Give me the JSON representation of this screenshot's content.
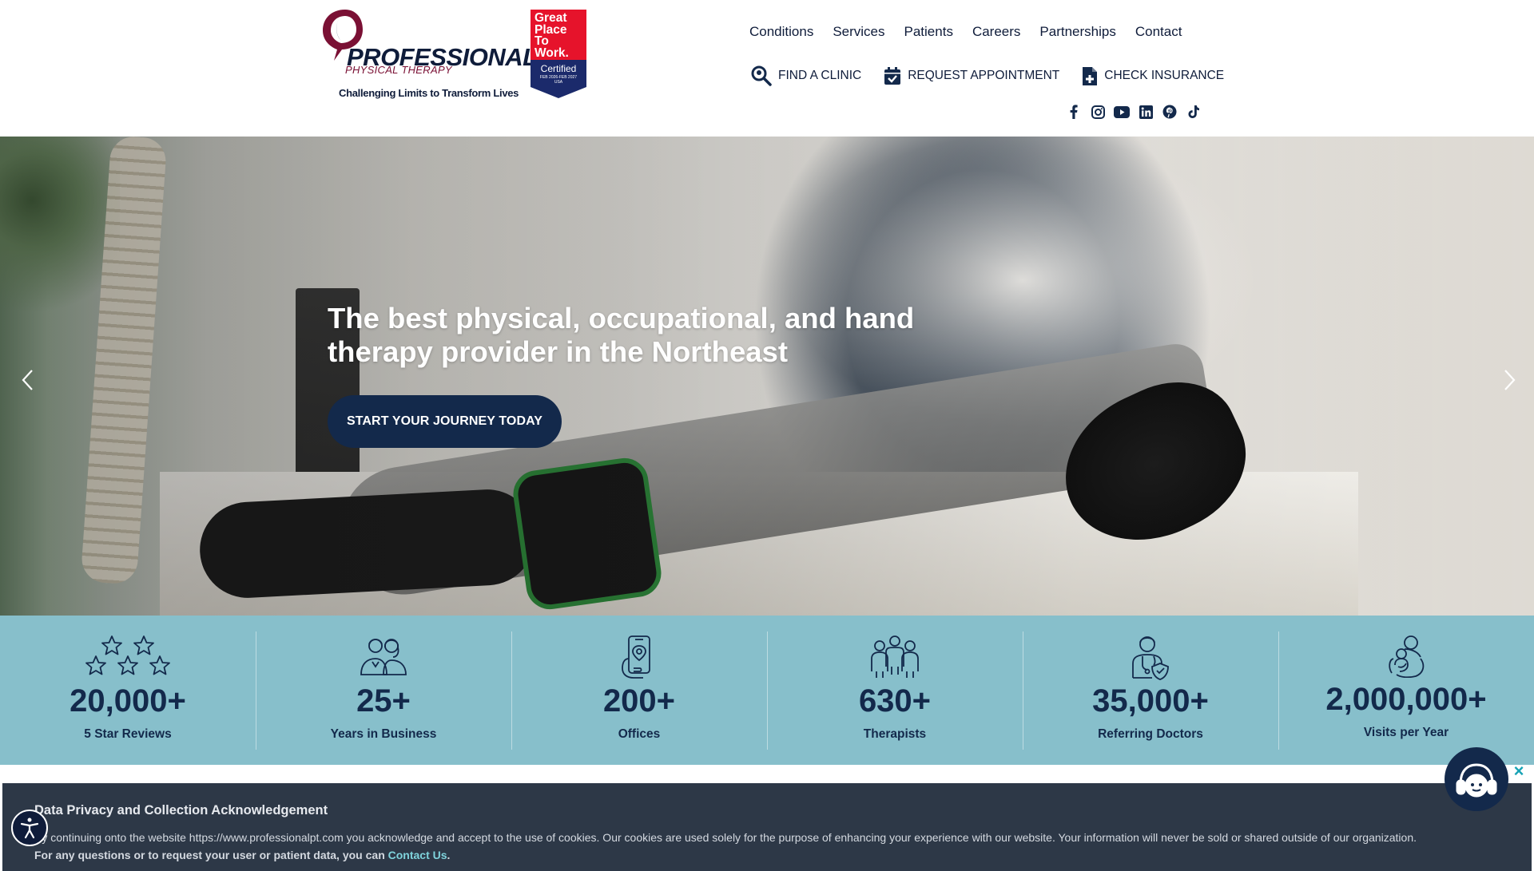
{
  "brand": {
    "logo_word": "PROFESSIONAL",
    "logo_sub": "PHYSICAL THERAPY",
    "tagline": "Challenging Limits to Transform Lives",
    "badge_lines": [
      "Great",
      "Place",
      "To",
      "Work."
    ],
    "badge_certified": "Certified",
    "badge_dates": "FEB 2026-FEB 2027",
    "badge_country": "USA"
  },
  "nav": {
    "items": [
      "Conditions",
      "Services",
      "Patients",
      "Careers",
      "Partnerships",
      "Contact"
    ]
  },
  "actions": {
    "find_clinic": "FIND A CLINIC",
    "request_appointment": "REQUEST APPOINTMENT",
    "check_insurance": "CHECK INSURANCE"
  },
  "social": [
    "facebook-icon",
    "instagram-icon",
    "youtube-icon",
    "linkedin-icon",
    "pinterest-icon",
    "tiktok-icon"
  ],
  "hero": {
    "title": "The best physical, occupational, and hand therapy provider in the Northeast",
    "cta": "START YOUR JOURNEY TODAY"
  },
  "stats": [
    {
      "value": "20,000+",
      "label": "5 Star Reviews",
      "icon": "stars-icon"
    },
    {
      "value": "25+",
      "label": "Years in Business",
      "icon": "team-icon"
    },
    {
      "value": "200+",
      "label": "Offices",
      "icon": "phone-location-icon"
    },
    {
      "value": "630+",
      "label": "Therapists",
      "icon": "therapists-icon"
    },
    {
      "value": "35,000+",
      "label": "Referring Doctors",
      "icon": "doctor-icon"
    },
    {
      "value": "2,000,000+",
      "label": "Visits per Year",
      "icon": "care-icon"
    }
  ],
  "cookie": {
    "title": "Data Privacy and Collection Acknowledgement",
    "text": "By continuing onto the website https://www.professionalpt.com you acknowledge and accept to the use of cookies. Our cookies are used solely for the purpose of enhancing your experience with our website. Your information will never be sold or shared outside of our organization.",
    "text2_prefix": "For any questions or to request your user or patient data, you can",
    "link": "Contact Us",
    "text2_suffix": "."
  },
  "colors": {
    "navy": "#13294b",
    "stats_bg": "#87bfcb",
    "banner_bg": "#2d3847",
    "brand_red": "#7a1034",
    "badge_red": "#e6132b"
  }
}
